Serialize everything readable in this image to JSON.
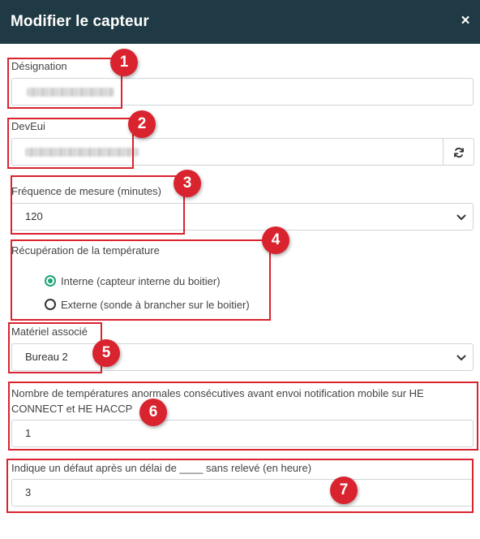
{
  "header": {
    "title": "Modifier le capteur",
    "close_label": "×"
  },
  "fields": {
    "designation": {
      "label": "Désignation",
      "value": ""
    },
    "deveui": {
      "label": "DevEui",
      "value": ""
    },
    "frequency": {
      "label": "Fréquence de mesure (minutes)",
      "value": "120"
    },
    "temperature_source": {
      "label": "Récupération de la température",
      "options": [
        {
          "label": "Interne (capteur interne du boitier)",
          "checked": true
        },
        {
          "label": "Externe (sonde à brancher sur le boitier)",
          "checked": false
        }
      ]
    },
    "equipment": {
      "label": "Matériel associé",
      "value": "Bureau 2"
    },
    "abnormal_count": {
      "label_line1": "Nombre de températures anormales consécutives avant envoi notification mobile sur HE",
      "label_line2": "CONNECT et HE HACCP",
      "value": "1"
    },
    "fault_delay": {
      "label": "Indique un défaut après un délai de ____ sans relevé (en heure)",
      "value": "3"
    }
  },
  "annotations": [
    "1",
    "2",
    "3",
    "4",
    "5",
    "6",
    "7"
  ],
  "colors": {
    "header_bg": "#1f3a44",
    "annotation_red": "#d9232e",
    "radio_checked": "#1fa37a"
  }
}
